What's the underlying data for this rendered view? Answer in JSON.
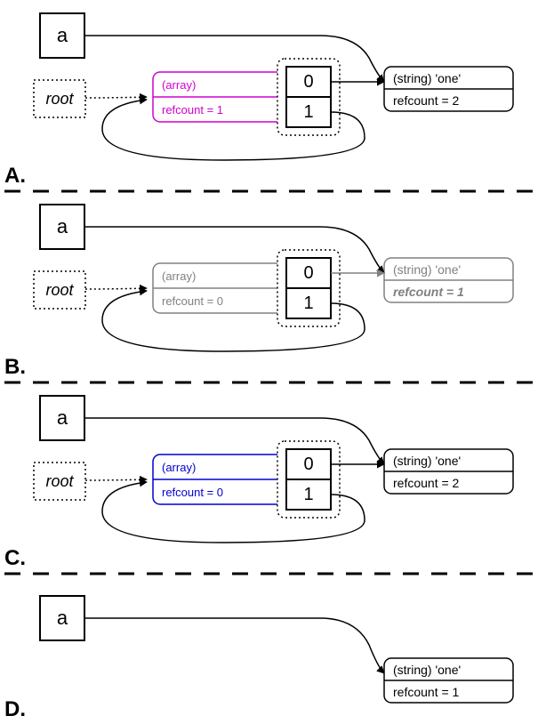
{
  "panels": {
    "A": {
      "label": "A.",
      "var_box": "a",
      "root_label": "root",
      "array_type": "(array)",
      "array_refcount": "refcount = 1",
      "array_color": "magenta",
      "indices": [
        "0",
        "1"
      ],
      "string_type": "(string) 'one'",
      "string_refcount": "refcount = 2",
      "string_style": "normal"
    },
    "B": {
      "label": "B.",
      "var_box": "a",
      "root_label": "root",
      "array_type": "(array)",
      "array_refcount": "refcount = 0",
      "array_color": "gray",
      "indices": [
        "0",
        "1"
      ],
      "string_type": "(string) 'one'",
      "string_refcount": "refcount = 1",
      "string_style": "gray-italic"
    },
    "C": {
      "label": "C.",
      "var_box": "a",
      "root_label": "root",
      "array_type": "(array)",
      "array_refcount": "refcount = 0",
      "array_color": "blue",
      "indices": [
        "0",
        "1"
      ],
      "string_type": "(string) 'one'",
      "string_refcount": "refcount = 2",
      "string_style": "normal"
    },
    "D": {
      "label": "D.",
      "var_box": "a",
      "string_type": "(string) 'one'",
      "string_refcount": "refcount = 1",
      "string_style": "normal"
    }
  },
  "colors": {
    "magenta": "#d000d0",
    "gray": "#808080",
    "blue": "#0000d0"
  }
}
